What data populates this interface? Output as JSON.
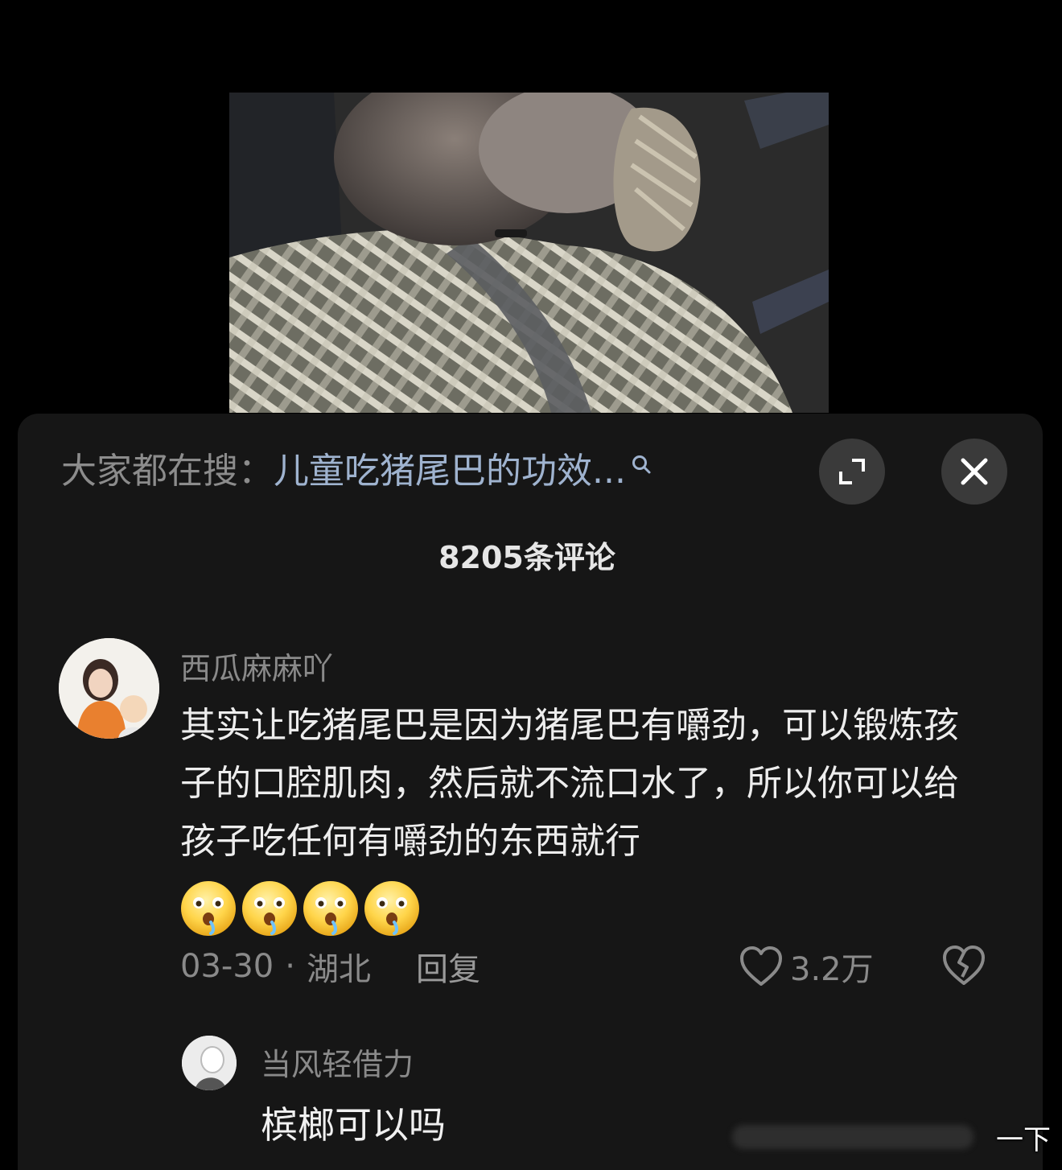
{
  "search": {
    "prefix": "大家都在搜：",
    "query": "儿童吃猪尾巴的功效..."
  },
  "header": {
    "comment_count": "8205条评论"
  },
  "comment": {
    "username": "西瓜麻麻吖",
    "text": "其实让吃猪尾巴是因为猪尾巴有嚼劲，可以锻炼孩子的口腔肌肉，然后就不流口水了，所以你可以给孩子吃任何有嚼劲的东西就行",
    "emoji_icon": "drooling-face-icon",
    "emoji_count": 4,
    "date": "03-30",
    "separator": "·",
    "location": "湖北",
    "reply_label": "回复",
    "likes": "3.2万"
  },
  "reply": {
    "username": "当风轻借力",
    "text": "槟榔可以吗"
  },
  "watermark": {
    "text": "一下"
  },
  "colors": {
    "background": "#000000",
    "panel": "#161616",
    "search_query": "#9fb3cf",
    "muted_text": "#8a8a8a",
    "button_bg": "#3a3a3a"
  }
}
